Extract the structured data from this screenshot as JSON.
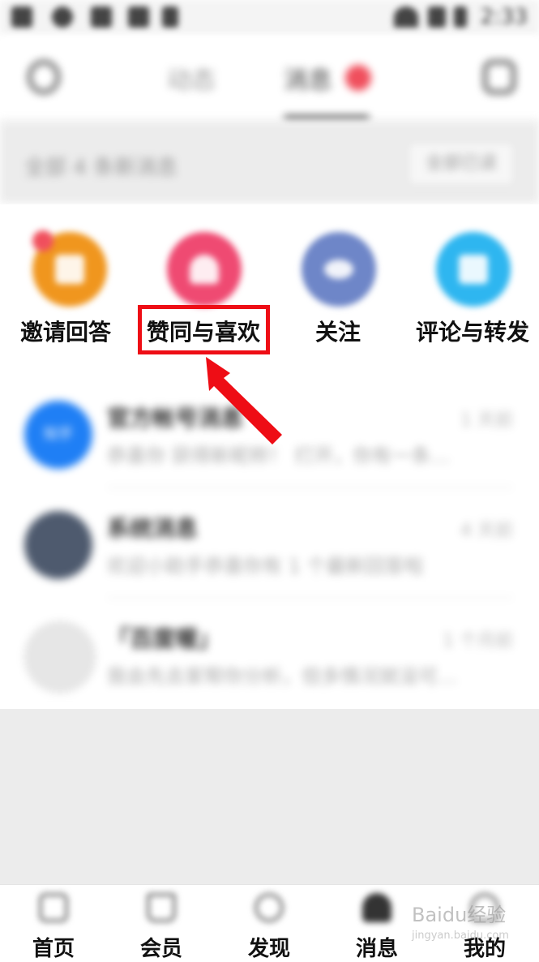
{
  "status_bar": {
    "time": "2:33"
  },
  "top_bar": {
    "tabs": [
      {
        "label": "动态"
      },
      {
        "label": "消息"
      }
    ]
  },
  "notice": {
    "text": "全部 4 条新消息",
    "button": "全部已读"
  },
  "categories": [
    {
      "label": "邀请回答",
      "color": "#f0961e"
    },
    {
      "label": "赞同与喜欢",
      "color": "#ef4a72"
    },
    {
      "label": "关注",
      "color": "#6e86c8"
    },
    {
      "label": "评论与转发",
      "color": "#2eb6f0"
    }
  ],
  "messages": [
    {
      "title": "官方帐号消息",
      "time": "1 天前",
      "preview": "恭喜你 获得新昵称！ 打开，你有一条…",
      "avatar_color": "#1f7ff5",
      "avatar_text": "知乎"
    },
    {
      "title": "系统消息",
      "time": "4 天前",
      "preview": "欢迎小助手恭喜你有 1 个最新回答啦",
      "avatar_color": "#4e5a6e"
    },
    {
      "title": "「百度喔」",
      "time": "1 个月前",
      "preview": "我会先去家帮你分析，但多情况就没可…",
      "avatar_color": "#e6e6e6"
    }
  ],
  "bottom_nav": [
    {
      "label": "首页"
    },
    {
      "label": "会员"
    },
    {
      "label": "发现"
    },
    {
      "label": "消息"
    },
    {
      "label": "我的"
    }
  ],
  "watermark": {
    "text": "Baidu经验",
    "url": "jingyan.baidu.com"
  },
  "colors": {
    "highlight": "#ee0d15",
    "badge": "#f04f5d"
  }
}
